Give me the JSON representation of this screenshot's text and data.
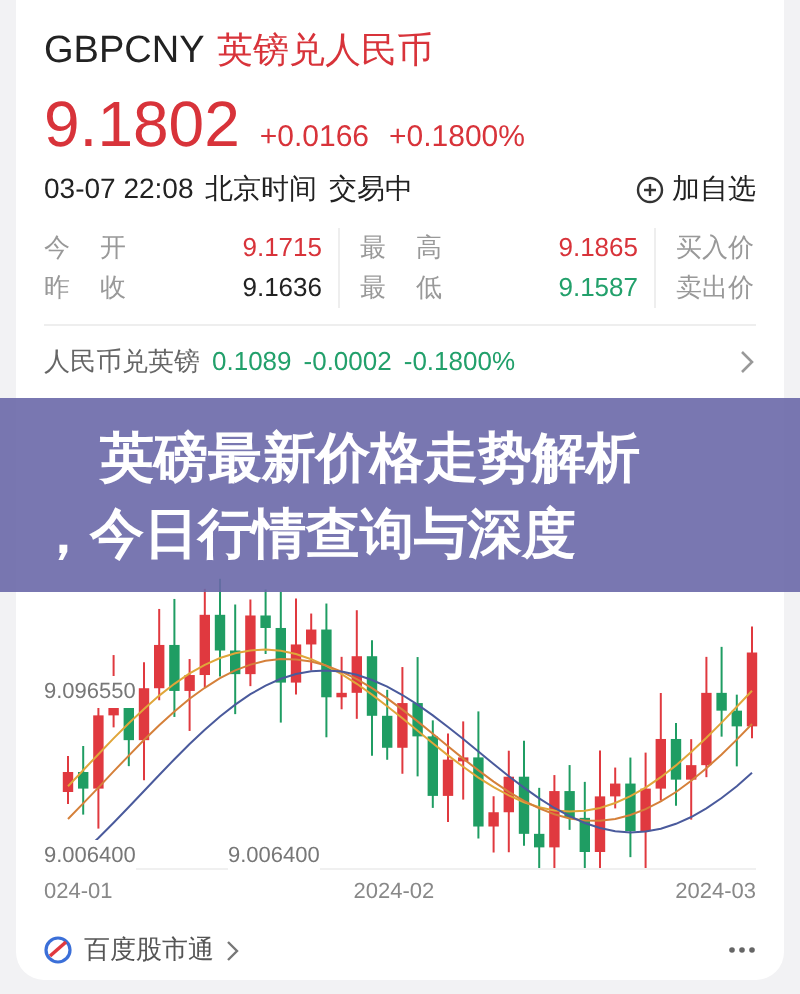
{
  "header": {
    "symbol": "GBPCNY",
    "name": "英镑兑人民币"
  },
  "quote": {
    "price": "9.1802",
    "change": "+0.0166",
    "change_pct": "+0.1800%"
  },
  "status": {
    "time": "03-07 22:08",
    "zone": "北京时间",
    "state": "交易中",
    "watch_button": "加自选"
  },
  "stats": [
    [
      {
        "kind": "pair",
        "label": [
          "今",
          "开"
        ],
        "value": "9.1715",
        "color": "#d8333a"
      },
      {
        "kind": "pair",
        "label": [
          "最",
          "高"
        ],
        "value": "9.1865",
        "color": "#d8333a"
      },
      {
        "kind": "label",
        "text": "买入价"
      }
    ],
    [
      {
        "kind": "pair",
        "label": [
          "昨",
          "收"
        ],
        "value": "9.1636",
        "color": "#222222"
      },
      {
        "kind": "pair",
        "label": [
          "最",
          "低"
        ],
        "value": "9.1587",
        "color": "#22a06b"
      },
      {
        "kind": "label",
        "text": "卖出价"
      }
    ]
  ],
  "inverse": {
    "label": "人民币兑英镑",
    "price": "0.1089",
    "change": "-0.0002",
    "change_pct": "-0.1800%"
  },
  "chart": {
    "y_labels": [
      "9.096550",
      "9.006400"
    ],
    "low_marker": "9.006400",
    "x_labels": [
      "024-01",
      "2024-02",
      "2024-03"
    ]
  },
  "footer": {
    "source": "百度股市通"
  },
  "banner": {
    "lines": [
      "英磅最新价格走势解析",
      "，今日行情查询与深度"
    ]
  }
}
